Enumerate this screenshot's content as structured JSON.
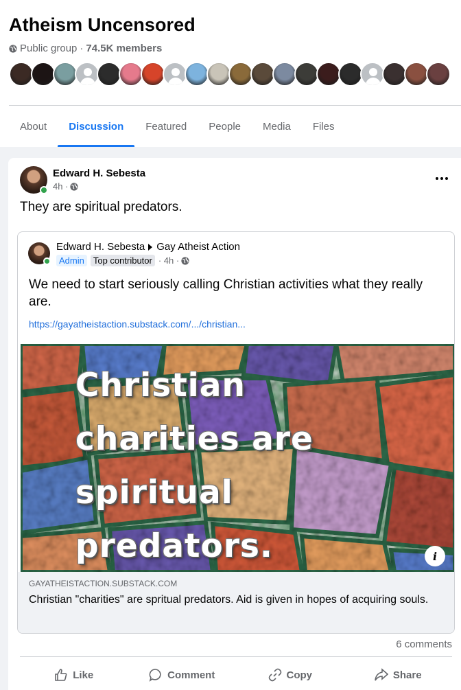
{
  "group": {
    "title": "Atheism Uncensored",
    "privacy": "Public group",
    "separator": "·",
    "members": "74.5K members",
    "member_avatar_colors": [
      "#3b2a24",
      "#1c1414",
      "#7a9ea0",
      "gray",
      "#2c2c2c",
      "#e57a8c",
      "#d6442a",
      "gray",
      "#7db3de",
      "#c9c4b8",
      "#8a6a3a",
      "#5a4a3a",
      "#7c8aa0",
      "#3c3c38",
      "#3b1c1c",
      "#2b2b2b",
      "gray",
      "#3a3030",
      "#8a5040",
      "#6a4040"
    ]
  },
  "tabs": [
    {
      "label": "About",
      "active": false
    },
    {
      "label": "Discussion",
      "active": true
    },
    {
      "label": "Featured",
      "active": false
    },
    {
      "label": "People",
      "active": false
    },
    {
      "label": "Media",
      "active": false
    },
    {
      "label": "Files",
      "active": false
    }
  ],
  "post": {
    "author": "Edward H. Sebesta",
    "time": "4h ·",
    "text": "They are spiritual predators.",
    "shared": {
      "author": "Edward H. Sebesta",
      "group": "Gay Atheist Action",
      "badge_admin": "Admin",
      "badge_contributor": "Top contributor",
      "time": "· 4h ·",
      "text": "We need to start seriously calling Christian activities what they really are.",
      "link": "https://gayatheistaction.substack.com/.../christian...",
      "image_lines": [
        "Christian",
        "charities are",
        "spiritual",
        "predators."
      ],
      "preview_domain": "GAYATHEISTACTION.SUBSTACK.COM",
      "preview_title": "Christian \"charities\" are spritual predators. Aid is given in hopes of acquiring souls."
    },
    "comments": "6 comments",
    "actions": {
      "like": "Like",
      "comment": "Comment",
      "copy": "Copy",
      "share": "Share"
    }
  },
  "colors": {
    "accent": "#1877f2",
    "link": "#216fdb",
    "secondary_text": "#65676b",
    "online": "#31a24c"
  }
}
